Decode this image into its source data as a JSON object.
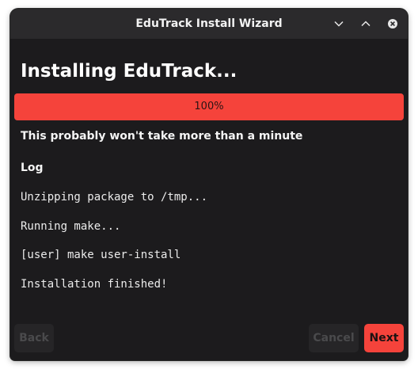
{
  "window": {
    "title": "EduTrack Install Wizard"
  },
  "page": {
    "heading": "Installing EduTrack...",
    "subtitle": "This probably won't take more than a minute",
    "log_title": "Log"
  },
  "progress": {
    "value": 1.0,
    "label": "100%"
  },
  "log": [
    "Unzipping package to /tmp...",
    "Running make...",
    "[user] make user-install",
    "Installation finished!"
  ],
  "buttons": {
    "back": "Back",
    "cancel": "Cancel",
    "next": "Next"
  },
  "icons": {
    "minimize": "chevron-down-icon",
    "maximize": "chevron-up-icon",
    "close": "close-icon"
  },
  "colors": {
    "accent": "#f5433b",
    "window_bg": "#1c1b1d",
    "titlebar_bg": "#2b2a2c"
  }
}
